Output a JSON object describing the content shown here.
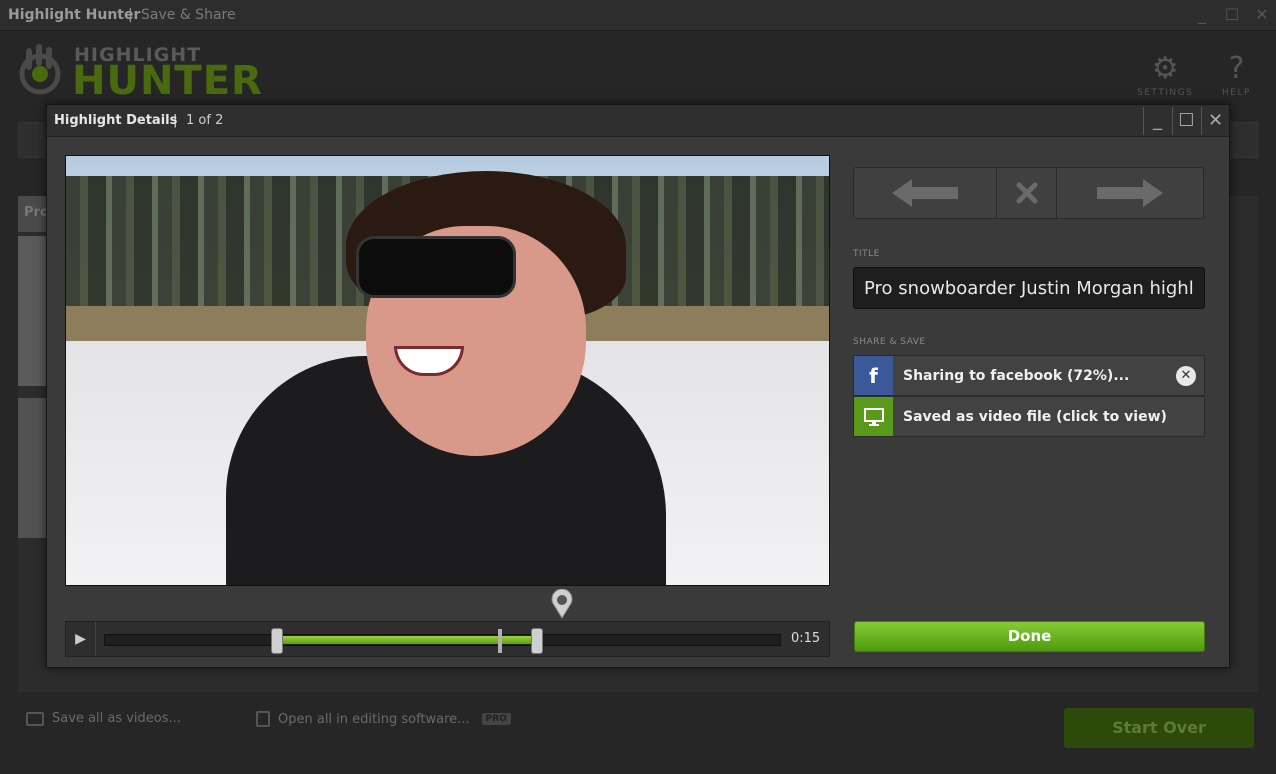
{
  "window": {
    "app_title": "Highlight Hunter",
    "separator": "|",
    "page_title": "Save & Share",
    "minimize": "_",
    "maximize": "☐",
    "close": "✕"
  },
  "header": {
    "logo_top": "HIGHLIGHT",
    "logo_bottom": "HUNTER",
    "settings_label": "SETTINGS",
    "help_label": "HELP",
    "help_glyph": "?",
    "settings_glyph": "⚙"
  },
  "background": {
    "strip_text": "Pro",
    "save_all_label": "Save all as videos...",
    "open_all_label": "Open all in editing software...",
    "pro_badge": "PRO",
    "start_over_label": "Start Over"
  },
  "modal": {
    "title": "Highlight Details",
    "separator": "|",
    "count": "1 of 2",
    "minimize": "_",
    "maximize": "☐",
    "close": "✕"
  },
  "player": {
    "play_glyph": "▶",
    "timecode": "0:15",
    "selection_start": 0.255,
    "selection_end": 0.64,
    "playhead": 0.585
  },
  "details": {
    "title_label": "TITLE",
    "title_value": "Pro snowboarder Justin Morgan highlight",
    "share_label": "SHARE & SAVE",
    "share_items": [
      {
        "icon": "facebook-icon",
        "glyph": "f",
        "text": "Sharing to facebook (72%)...",
        "color": "#3b5998"
      },
      {
        "icon": "monitor-icon",
        "glyph": "🖵",
        "text": "Saved as video file (click to view)",
        "color": "#5a9a1a"
      }
    ],
    "cancel_glyph": "✕",
    "done_label": "Done"
  },
  "colors": {
    "accent": "#6fb524",
    "facebook": "#3b5998"
  }
}
